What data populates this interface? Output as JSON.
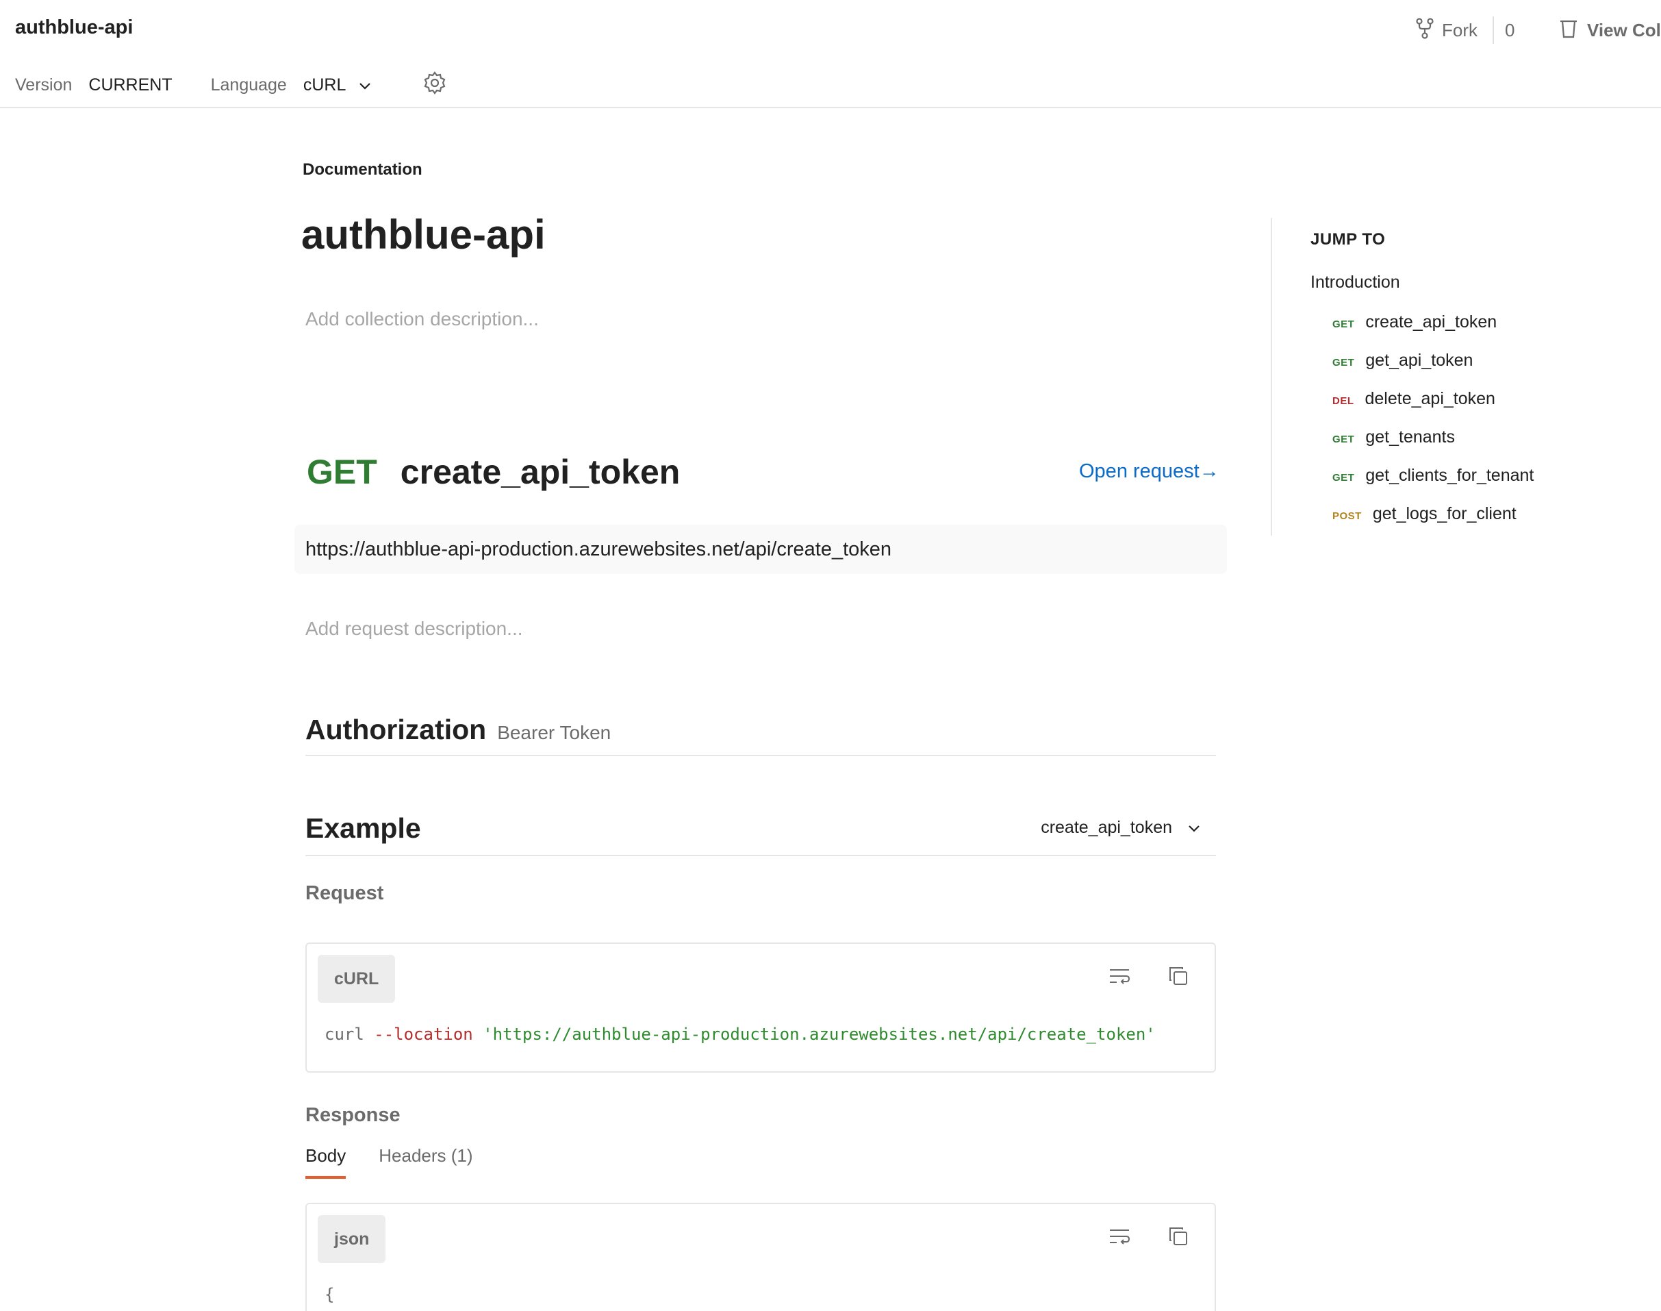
{
  "header": {
    "title": "authblue-api",
    "fork_label": "Fork",
    "fork_count": "0",
    "view_collection_label": "View Coll"
  },
  "controls": {
    "version_label": "Version",
    "version_value": "CURRENT",
    "language_label": "Language",
    "language_value": "cURL"
  },
  "doc": {
    "section_label": "Documentation",
    "collection_title": "authblue-api",
    "collection_desc_placeholder": "Add collection description..."
  },
  "request": {
    "method": "GET",
    "name": "create_api_token",
    "open_label": "Open request→",
    "url": "https://authblue-api-production.azurewebsites.net/api/create_token",
    "desc_placeholder": "Add request description...",
    "auth_title": "Authorization",
    "auth_type": "Bearer Token"
  },
  "example": {
    "title": "Example",
    "selected": "create_api_token",
    "request_label": "Request",
    "request_lang": "cURL",
    "curl_cmd": "curl",
    "curl_flag": "--location",
    "curl_url": "'https://authblue-api-production.azurewebsites.net/api/create_token'",
    "response_label": "Response",
    "tabs": [
      {
        "label": "Body"
      },
      {
        "label": "Headers (1)"
      }
    ],
    "response_lang": "json",
    "response_first_line": "{"
  },
  "jump_to": {
    "title": "JUMP TO",
    "intro": "Introduction",
    "items": [
      {
        "method": "GET",
        "label": "create_api_token"
      },
      {
        "method": "GET",
        "label": "get_api_token"
      },
      {
        "method": "DEL",
        "label": "delete_api_token"
      },
      {
        "method": "GET",
        "label": "get_tenants"
      },
      {
        "method": "GET",
        "label": "get_clients_for_tenant"
      },
      {
        "method": "POST",
        "label": "get_logs_for_client"
      }
    ]
  },
  "colors": {
    "get": "#2f7d32",
    "del": "#b32d2d",
    "post": "#b5831f",
    "link": "#0b6bcb",
    "tab_active": "#e85d2e"
  },
  "icons": {
    "fork": "fork-icon",
    "view_collection": "trash-icon",
    "language_chevron": "chevron-down-icon",
    "settings": "gear-icon",
    "wrap": "wrap-lines-icon",
    "copy": "copy-icon"
  }
}
